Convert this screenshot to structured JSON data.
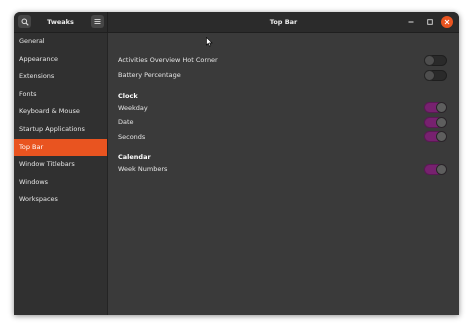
{
  "app": {
    "title": "Tweaks"
  },
  "window": {
    "title": "Top Bar"
  },
  "icons": {
    "search": "search-icon",
    "menu": "hamburger-menu-icon",
    "minimize": "minimize-icon",
    "maximize": "maximize-icon",
    "close": "close-icon"
  },
  "colors": {
    "accent": "#e95420",
    "toggle_on": "#77216f"
  },
  "sidebar": {
    "items": [
      {
        "label": "General"
      },
      {
        "label": "Appearance"
      },
      {
        "label": "Extensions"
      },
      {
        "label": "Fonts"
      },
      {
        "label": "Keyboard & Mouse"
      },
      {
        "label": "Startup Applications"
      },
      {
        "label": "Top Bar",
        "selected": true
      },
      {
        "label": "Window Titlebars"
      },
      {
        "label": "Windows"
      },
      {
        "label": "Workspaces"
      }
    ]
  },
  "main": {
    "settings": [
      {
        "label": "Activities Overview Hot Corner",
        "enabled": false
      },
      {
        "label": "Battery Percentage",
        "enabled": false
      }
    ],
    "clock": {
      "heading": "Clock",
      "settings": [
        {
          "label": "Weekday",
          "enabled": true
        },
        {
          "label": "Date",
          "enabled": true
        },
        {
          "label": "Seconds",
          "enabled": true
        }
      ]
    },
    "calendar": {
      "heading": "Calendar",
      "settings": [
        {
          "label": "Week Numbers",
          "enabled": true
        }
      ]
    }
  }
}
